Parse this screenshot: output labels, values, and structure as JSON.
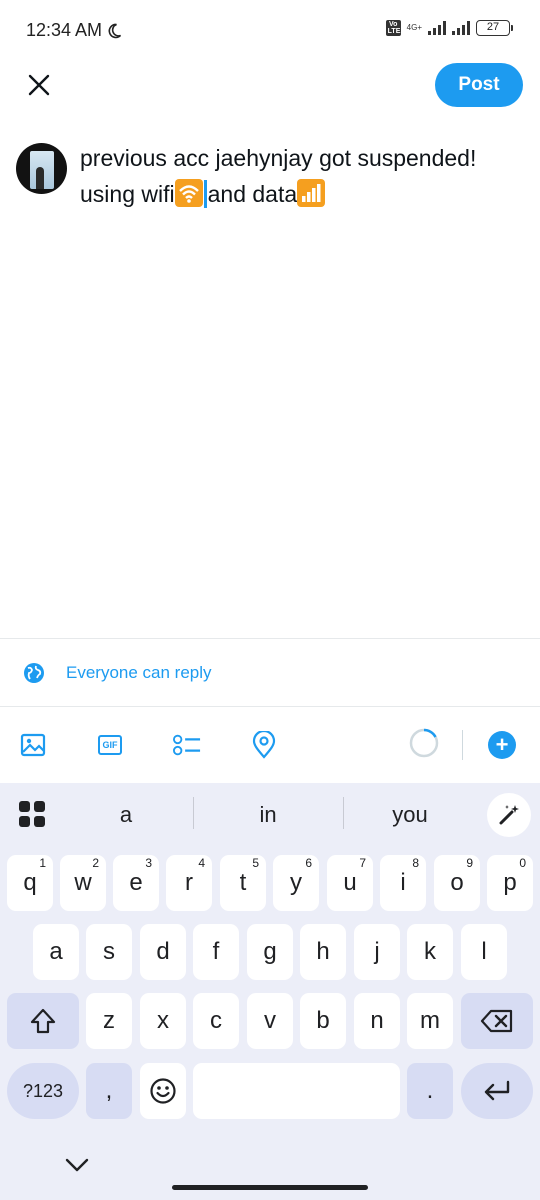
{
  "status_bar": {
    "time": "12:34 AM",
    "volte": "Vo LTE",
    "network": "4G+",
    "battery": "27"
  },
  "header": {
    "close_icon": "close-icon",
    "post_label": "Post"
  },
  "compose": {
    "text_part1": "previous acc jaehynjay got suspended! using wifi",
    "text_part2": "and data",
    "emoji_1": "wifi-emoji",
    "emoji_2": "antenna-bars-emoji"
  },
  "reply_setting": {
    "label": "Everyone can reply"
  },
  "toolbar": {
    "icons": [
      "image-icon",
      "gif-icon",
      "poll-icon",
      "location-icon"
    ],
    "gif_label": "GIF"
  },
  "keyboard": {
    "suggestions": [
      "a",
      "in",
      "you"
    ],
    "row1": [
      {
        "key": "q",
        "hint": "1"
      },
      {
        "key": "w",
        "hint": "2"
      },
      {
        "key": "e",
        "hint": "3"
      },
      {
        "key": "r",
        "hint": "4"
      },
      {
        "key": "t",
        "hint": "5"
      },
      {
        "key": "y",
        "hint": "6"
      },
      {
        "key": "u",
        "hint": "7"
      },
      {
        "key": "i",
        "hint": "8"
      },
      {
        "key": "o",
        "hint": "9"
      },
      {
        "key": "p",
        "hint": "0"
      }
    ],
    "row2": [
      "a",
      "s",
      "d",
      "f",
      "g",
      "h",
      "j",
      "k",
      "l"
    ],
    "row3": [
      "z",
      "x",
      "c",
      "v",
      "b",
      "n",
      "m"
    ],
    "sym_label": "?123",
    "comma": ",",
    "period": "."
  },
  "colors": {
    "accent": "#1d9bf0",
    "keyboard_bg": "#eceef8",
    "key_dark": "#d7dcf3"
  }
}
